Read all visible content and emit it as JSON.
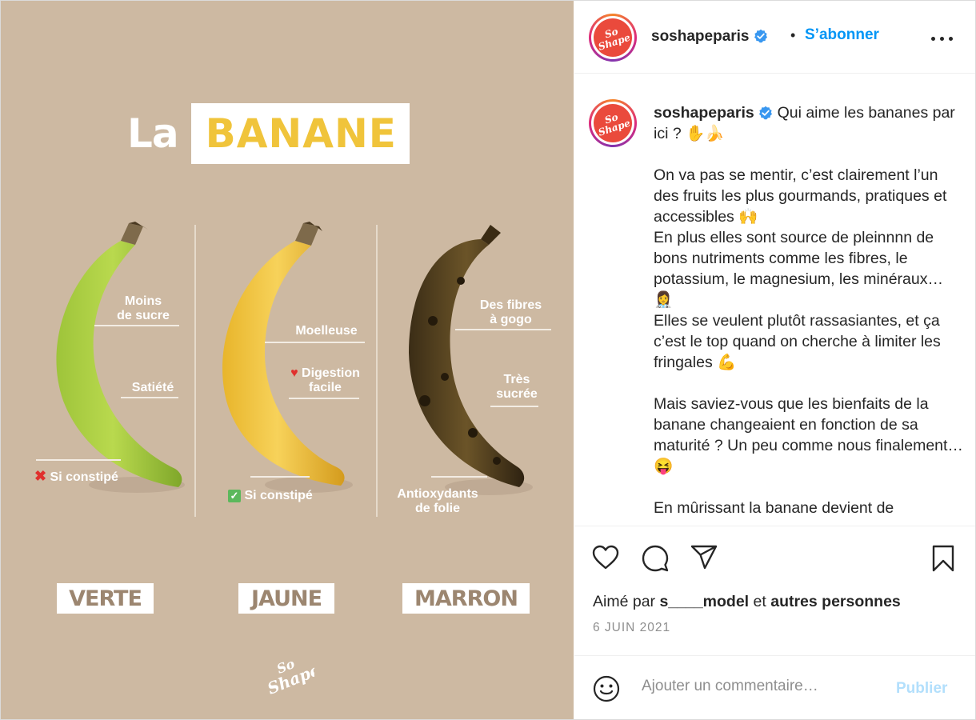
{
  "image": {
    "title_la": "La",
    "title_banane": "BANANE",
    "stages": [
      {
        "label": "VERTE"
      },
      {
        "label": "JAUNE"
      },
      {
        "label": "MARRON"
      }
    ],
    "green_labels": {
      "l1a": "Moins",
      "l1b": "de sucre",
      "l2": "Satiété",
      "l3": "Si constipé",
      "l3_icon": "red-cross"
    },
    "yellow_labels": {
      "l1": "Moelleuse",
      "l2a": "Digestion",
      "l2b": "facile",
      "l2_icon": "red-heart",
      "l3": "Si constipé",
      "l3_icon": "green-check"
    },
    "brown_labels": {
      "l1a": "Des fibres",
      "l1b": "à gogo",
      "l2a": "Très",
      "l2b": "sucrée",
      "l3a": "Antioxydants",
      "l3b": "de folie"
    },
    "logo_text_top": "So",
    "logo_text_bottom": "Shape",
    "colors": {
      "background": "#cdb9a2",
      "accent_yellow": "#f0c43b",
      "stage_text": "#9c8670"
    }
  },
  "header": {
    "username": "soshapeparis",
    "separator": "•",
    "follow_label": "S’abonner",
    "avatar_text_top": "So",
    "avatar_text_bottom": "Shape"
  },
  "caption": {
    "username": "soshapeparis",
    "p1": "Qui aime les bananes par ici ? ✋🍌",
    "p2": "On va pas se mentir, c’est clairement l’un des fruits les plus gourmands, pratiques et accessibles 🙌",
    "p3": "En plus elles sont source de pleinnnn de bons nutriments comme les fibres, le potassium, le magnesium, les minéraux… 👩‍⚕️",
    "p4": "Elles se veulent plutôt rassasiantes, et ça c’est le top quand on cherche à limiter les fringales 💪",
    "p5": "Mais saviez-vous que les bienfaits de la banane changeaient en fonction de sa maturité ? Un peu comme nous finalement… 😝",
    "p6": "En mûrissant la banane devient de"
  },
  "actions": {
    "liked_prefix": "Aimé par",
    "liked_user": "s____model",
    "liked_mid": "et",
    "liked_rest": "autres personnes",
    "date": "6 JUIN 2021"
  },
  "comment": {
    "placeholder": "Ajouter un commentaire…",
    "publish_label": "Publier"
  },
  "theme": {
    "link_blue": "#0095f6",
    "publish_disabled": "#b2dffc",
    "muted": "#8e8e8e",
    "verified_blue": "#3897f0"
  }
}
